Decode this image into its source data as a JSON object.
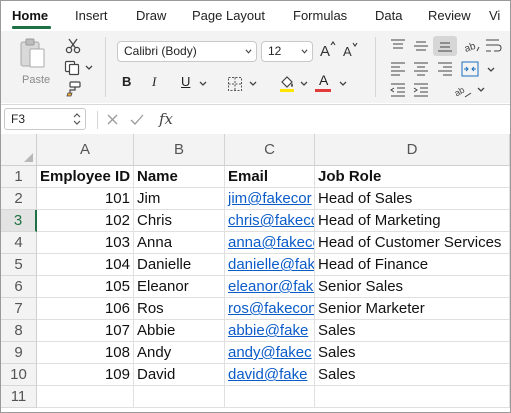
{
  "ribbon_tabs": [
    "Home",
    "Insert",
    "Draw",
    "Page Layout",
    "Formulas",
    "Data",
    "Review",
    "Vi"
  ],
  "ribbon": {
    "paste_label": "Paste",
    "font_name": "Calibri (Body)",
    "font_size": "12",
    "bold": "B",
    "italic": "I",
    "underline": "U",
    "font_color_letter": "A",
    "font_color": "#e03a3a",
    "highlight_color": "#ffe600"
  },
  "formula_bar": {
    "cell_ref": "F3",
    "fx": "fx",
    "formula": ""
  },
  "columns": [
    "A",
    "B",
    "C",
    "D"
  ],
  "rows": [
    {
      "n": "1",
      "a": "Employee ID",
      "b": "Name",
      "c": "Email",
      "d": "Job Role"
    },
    {
      "n": "2",
      "a": "101",
      "b": "Jim",
      "c": "jim@fakecor",
      "d": "Head of Sales"
    },
    {
      "n": "3",
      "a": "102",
      "b": "Chris",
      "c": "chris@fakeco",
      "d": "Head of Marketing"
    },
    {
      "n": "4",
      "a": "103",
      "b": "Anna",
      "c": "anna@fakeco",
      "d": "Head of Customer Services"
    },
    {
      "n": "5",
      "a": "104",
      "b": "Danielle",
      "c": "danielle@fak",
      "d": "Head of Finance"
    },
    {
      "n": "6",
      "a": "105",
      "b": "Eleanor",
      "c": "eleanor@fake",
      "d": "Senior Sales"
    },
    {
      "n": "7",
      "a": "106",
      "b": "Ros",
      "c": "ros@fakecon",
      "d": "Senior Marketer"
    },
    {
      "n": "8",
      "a": "107",
      "b": "Abbie",
      "c": "abbie@fake",
      "d": "Sales"
    },
    {
      "n": "9",
      "a": "108",
      "b": "Andy",
      "c": "andy@fakec",
      "d": "Sales"
    },
    {
      "n": "10",
      "a": "109",
      "b": "David",
      "c": "david@fake",
      "d": "Sales"
    },
    {
      "n": "11",
      "a": "",
      "b": "",
      "c": "",
      "d": ""
    }
  ],
  "active_row": "3",
  "accent": "#1e7145"
}
